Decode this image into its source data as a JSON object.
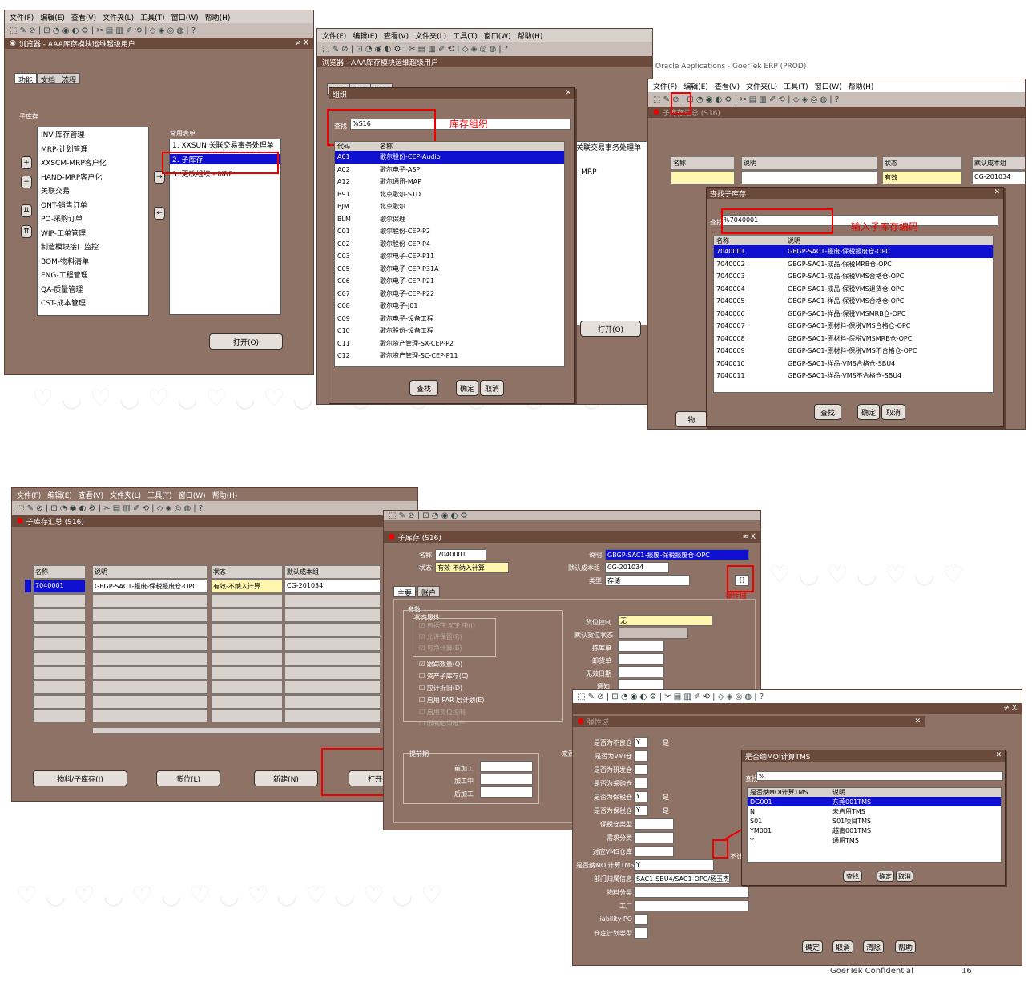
{
  "win1": {
    "menu": [
      "文件(F)",
      "编辑(E)",
      "查看(V)",
      "文件夹(L)",
      "工具(T)",
      "窗口(W)",
      "帮助(H)"
    ],
    "title": "浏览器 - AAA库存模块运维超级用户",
    "tabs": [
      "功能",
      "文档",
      "流程"
    ],
    "subinv_label": "子库存",
    "tree_items": [
      "INV-库存管理",
      "MRP-计划管理",
      "XXSCM-MRP客户化",
      "HAND-MRP客户化",
      "关联交易",
      "ONT-销售订单",
      "PO-采购订单",
      "WIP-工单管理",
      "制造模块接口监控",
      "BOM-物料清单",
      "ENG-工程管理",
      "QA-质量管理",
      "CST-成本管理"
    ],
    "common_label": "常用表单",
    "common_items": [
      "1. XXSUN 关联交易事务处理单",
      "2. 子库存",
      "3. 更改组织 - MRP"
    ],
    "open_btn": "打开(O)"
  },
  "win2": {
    "menu": [
      "文件(F)",
      "编辑(E)",
      "查看(V)",
      "文件夹(L)",
      "工具(T)",
      "窗口(W)",
      "帮助(H)"
    ],
    "bg_title": "浏览器 - AAA库存模块运维超级用户",
    "bg_tabs": [
      "功能",
      "文档",
      "流程"
    ],
    "bg_item1": "关联交易事务处理单",
    "bg_item2": "- MRP",
    "bg_open": "打开(O)",
    "dialog_title": "组织",
    "find_label": "查找",
    "find_value": "%S16",
    "annotation": "库存组织",
    "col_code": "代码",
    "col_name": "名称",
    "rows": [
      [
        "A01",
        "歌尔股份-CEP-Audio"
      ],
      [
        "A02",
        "歌尔电子-ASP"
      ],
      [
        "A12",
        "歌尔通讯-MAP"
      ],
      [
        "B91",
        "北京歌尔-STD"
      ],
      [
        "BJM",
        "北京歌尔"
      ],
      [
        "BLM",
        "歌尔保理"
      ],
      [
        "C01",
        "歌尔股份-CEP-P2"
      ],
      [
        "C02",
        "歌尔股份-CEP-P4"
      ],
      [
        "C03",
        "歌尔电子-CEP-P11"
      ],
      [
        "C05",
        "歌尔电子-CEP-P31A"
      ],
      [
        "C06",
        "歌尔电子-CEP-P21"
      ],
      [
        "C07",
        "歌尔电子-CEP-P22"
      ],
      [
        "C08",
        "歌尔电子-J01"
      ],
      [
        "C09",
        "歌尔电子-设备工程"
      ],
      [
        "C10",
        "歌尔股份-设备工程"
      ],
      [
        "C11",
        "歌尔资产管理-SX-CEP-P2"
      ],
      [
        "C12",
        "歌尔资产管理-SC-CEP-P11"
      ]
    ],
    "btn_find": "查找",
    "btn_ok": "确定",
    "btn_cancel": "取消"
  },
  "win3": {
    "top_text": "Oracle Applications - GoerTek ERP (PROD)",
    "menu": [
      "文件(F)",
      "编辑(E)",
      "查看(V)",
      "文件夹(L)",
      "工具(T)",
      "窗口(W)",
      "帮助(H)"
    ],
    "form_title": "子库存汇总 (S16)",
    "col_name": "名称",
    "col_desc": "说明",
    "col_status": "状态",
    "col_cost": "默认成本组",
    "status_value": "有效",
    "cost_value": "CG-201034",
    "dialog_title": "查找子库存",
    "find_label": "查找",
    "find_value": "%7040001",
    "annotation": "输入子库存编码",
    "list_col_name": "名称",
    "list_col_desc": "说明",
    "rows": [
      [
        "7040001",
        "GBGP-SAC1-报废-保税报废仓-OPC"
      ],
      [
        "7040002",
        "GBGP-SAC1-成品-保税MRB仓-OPC"
      ],
      [
        "7040003",
        "GBGP-SAC1-成品-保税VMS合格仓-OPC"
      ],
      [
        "7040004",
        "GBGP-SAC1-成品-保税VMS退货仓-OPC"
      ],
      [
        "7040005",
        "GBGP-SAC1-样品-保税VMS合格仓-OPC"
      ],
      [
        "7040006",
        "GBGP-SAC1-样品-保税VMSMRB仓-OPC"
      ],
      [
        "7040007",
        "GBGP-SAC1-原材料-保税VMS合格仓-OPC"
      ],
      [
        "7040008",
        "GBGP-SAC1-原材料-保税VMSMRB仓-OPC"
      ],
      [
        "7040009",
        "GBGP-SAC1-原材料-保税VMS不合格仓-OPC"
      ],
      [
        "7040010",
        "GBGP-SAC1-样品-VMS合格仓-SBU4"
      ],
      [
        "7040011",
        "GBGP-SAC1-样品-VMS不合格仓-SBU4"
      ]
    ],
    "btn_find": "查找",
    "btn_ok": "确定",
    "btn_cancel": "取消",
    "bg_btn": "物"
  },
  "win4": {
    "menu": [
      "文件(F)",
      "编辑(E)",
      "查看(V)",
      "文件夹(L)",
      "工具(T)",
      "窗口(W)",
      "帮助(H)"
    ],
    "title": "子库存汇总 (S16)",
    "col_name": "名称",
    "col_desc": "说明",
    "col_status": "状态",
    "col_cost": "默认成本组",
    "row_name": "7040001",
    "row_desc": "GBGP-SAC1-报废-保税报废仓-OPC",
    "row_status": "有效-不纳入计算",
    "row_cost": "CG-201034",
    "btn_items": "物料/子库存(I)",
    "btn_locators": "货位(L)",
    "btn_new": "新建(N)",
    "btn_open": "打开(O)"
  },
  "win5": {
    "title": "子库存 (S16)",
    "lbl_name": "名称",
    "val_name": "7040001",
    "lbl_status": "状态",
    "val_status": "有效-不纳入计算",
    "lbl_desc": "说明",
    "val_desc": "GBGP-SAC1-报废-保税报废仓-OPC",
    "lbl_cost": "默认成本组",
    "val_cost": "CG-201034",
    "lbl_type": "类型",
    "val_type": "存储",
    "annotation": "弹性域",
    "tabs": [
      "主要",
      "账户"
    ],
    "params_label": "参数",
    "status_attr_label": "状态属性",
    "status_checks": [
      "包括在 ATP 中(I)",
      "允许保留(R)",
      "可净计算(B)"
    ],
    "checks": [
      "跟踪数量(Q)",
      "资产子库存(C)",
      "应计折旧(D)",
      "启用 PAR 层计划(E)"
    ],
    "disabled_checks": [
      "启用货位控制",
      "限制必须唯一"
    ],
    "lbl_locator_ctl": "货位控制",
    "val_locator_ctl": "无",
    "lbl_default_loc_status": "默认货位状态",
    "lbl_pick": "拣库单",
    "lbl_putaway": "卸货单",
    "lbl_inactive": "无效日期",
    "lbl_notify": "通知",
    "leadtime_label": "提前期",
    "lbl_pre": "前加工",
    "lbl_proc": "加工中",
    "lbl_post": "后加工",
    "source_label": "来源"
  },
  "win6": {
    "panel_title": "弹性域",
    "fields": [
      {
        "label": "是否为不良仓",
        "value": "Y",
        "desc": "是"
      },
      {
        "label": "是否为VMI仓",
        "value": "",
        "desc": ""
      },
      {
        "label": "是否为研发仓",
        "value": "",
        "desc": ""
      },
      {
        "label": "是否为采购仓",
        "value": "",
        "desc": ""
      },
      {
        "label": "是否为保税仓",
        "value": "Y",
        "desc": "是"
      },
      {
        "label": "是否为保税仓",
        "value": "Y",
        "desc": "是"
      },
      {
        "label": "保税仓类型",
        "value": "",
        "desc": ""
      },
      {
        "label": "需求分类",
        "value": "",
        "desc": ""
      },
      {
        "label": "对应VMS仓库",
        "value": "",
        "desc": ""
      },
      {
        "label": "是否纳MOI计算TMS",
        "value": "Y",
        "desc": ""
      },
      {
        "label": "部门归属信息",
        "value": "SAC1-SBU4/SAC1-OPC/杨玉杰",
        "desc": ""
      },
      {
        "label": "物料分类",
        "value": "",
        "desc": ""
      },
      {
        "label": "工厂",
        "value": "",
        "desc": ""
      },
      {
        "label": "liability PO",
        "value": "",
        "desc": ""
      },
      {
        "label": "仓库计划类型",
        "value": "",
        "desc": ""
      }
    ],
    "tms_label": "不计TMS",
    "btn_ok": "确定",
    "btn_cancel": "取消",
    "btn_clear": "清除",
    "btn_help": "帮助",
    "lov_title": "是否纳MOI计算TMS",
    "lov_find_label": "查找",
    "lov_find_value": "%",
    "lov_col1": "是否纳MOI计算TMS",
    "lov_col2": "说明",
    "lov_rows": [
      [
        "DG001",
        "东莞001TMS"
      ],
      [
        "N",
        "未启用TMS"
      ],
      [
        "S01",
        "S01项目TMS"
      ],
      [
        "YM001",
        "越南001TMS"
      ],
      [
        "Y",
        "通用TMS"
      ]
    ],
    "lov_btn_find": "查找",
    "lov_btn_ok": "确定",
    "lov_btn_cancel": "取消"
  },
  "footer": {
    "company": "GoerTek Confidential",
    "page": "16"
  },
  "colors": {
    "form_bg": "#8e7266",
    "title_bg": "#6b4a3c",
    "highlight": "#e00000",
    "selection": "#1010d0"
  }
}
